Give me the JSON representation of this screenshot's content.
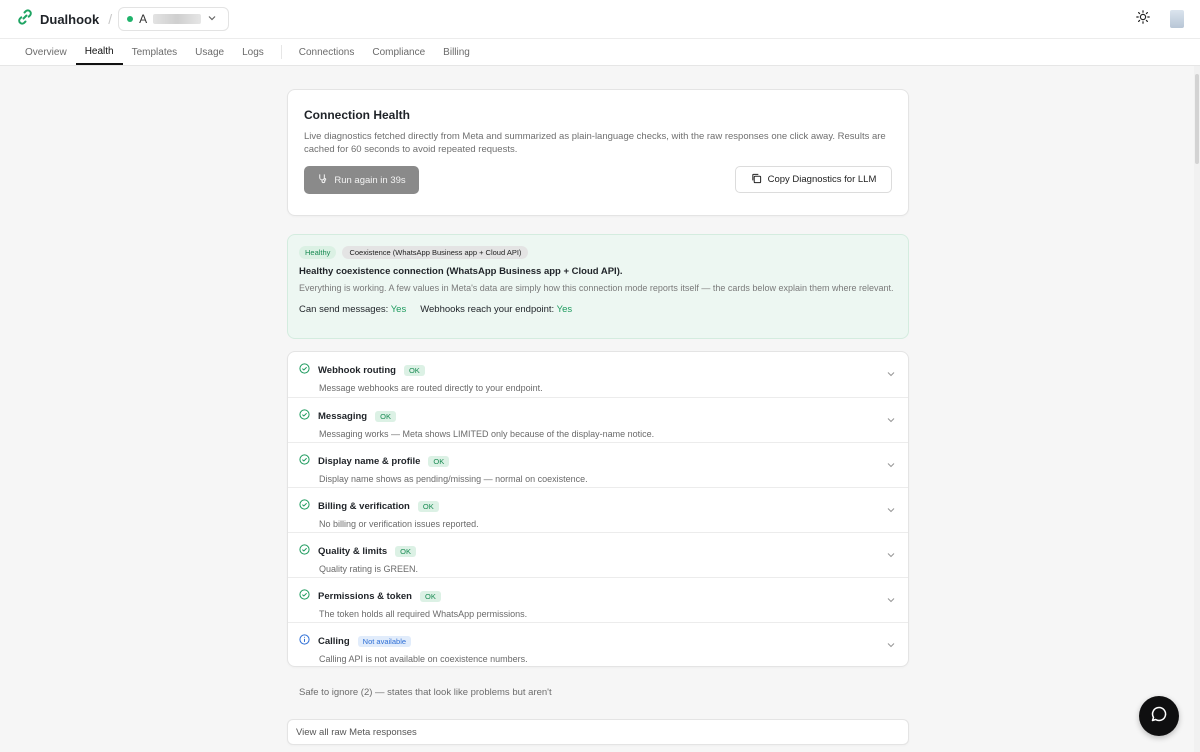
{
  "brand": {
    "name": "Dualhook"
  },
  "workspace": {
    "name": "A",
    "status_color": "#1fb36b"
  },
  "tabs": [
    {
      "label": "Overview"
    },
    {
      "label": "Health",
      "active": true
    },
    {
      "label": "Templates"
    },
    {
      "label": "Usage"
    },
    {
      "label": "Logs"
    },
    {
      "label": "Connections"
    },
    {
      "label": "Compliance"
    },
    {
      "label": "Billing"
    }
  ],
  "health": {
    "title": "Connection Health",
    "description": "Live diagnostics fetched directly from Meta and summarized as plain-language checks, with the raw responses one click away. Results are cached for 60 seconds to avoid repeated requests.",
    "run_button": "Run again in 39s",
    "copy_button": "Copy Diagnostics for LLM"
  },
  "status": {
    "badge": "Healthy",
    "mode": "Coexistence (WhatsApp Business app + Cloud API)",
    "title": "Healthy coexistence connection (WhatsApp Business app + Cloud API).",
    "description": "Everything is working. A few values in Meta's data are simply how this connection mode reports itself — the cards below explain them where relevant.",
    "send_label": "Can send messages:",
    "send_value": "Yes",
    "webhook_label": "Webhooks reach your endpoint:",
    "webhook_value": "Yes"
  },
  "checks": [
    {
      "title": "Webhook routing",
      "badge": "OK",
      "desc": "Message webhooks are routed directly to your endpoint."
    },
    {
      "title": "Messaging",
      "badge": "OK",
      "desc": "Messaging works — Meta shows LIMITED only because of the display-name notice."
    },
    {
      "title": "Display name & profile",
      "badge": "OK",
      "desc": "Display name shows as pending/missing — normal on coexistence."
    },
    {
      "title": "Billing & verification",
      "badge": "OK",
      "desc": "No billing or verification issues reported."
    },
    {
      "title": "Quality & limits",
      "badge": "OK",
      "desc": "Quality rating is GREEN."
    },
    {
      "title": "Permissions & token",
      "badge": "OK",
      "desc": "The token holds all required WhatsApp permissions."
    },
    {
      "title": "Calling",
      "badge": "Not available",
      "desc": "Calling API is not available on coexistence numbers."
    }
  ],
  "safe_to_ignore": "Safe to ignore (2) — states that look like problems but aren't",
  "raw_responses": "View all raw Meta responses",
  "colors": {
    "ok_green": "#1c9a5d",
    "info_blue": "#2e6fd6",
    "accent_dark": "#0f0f10"
  }
}
